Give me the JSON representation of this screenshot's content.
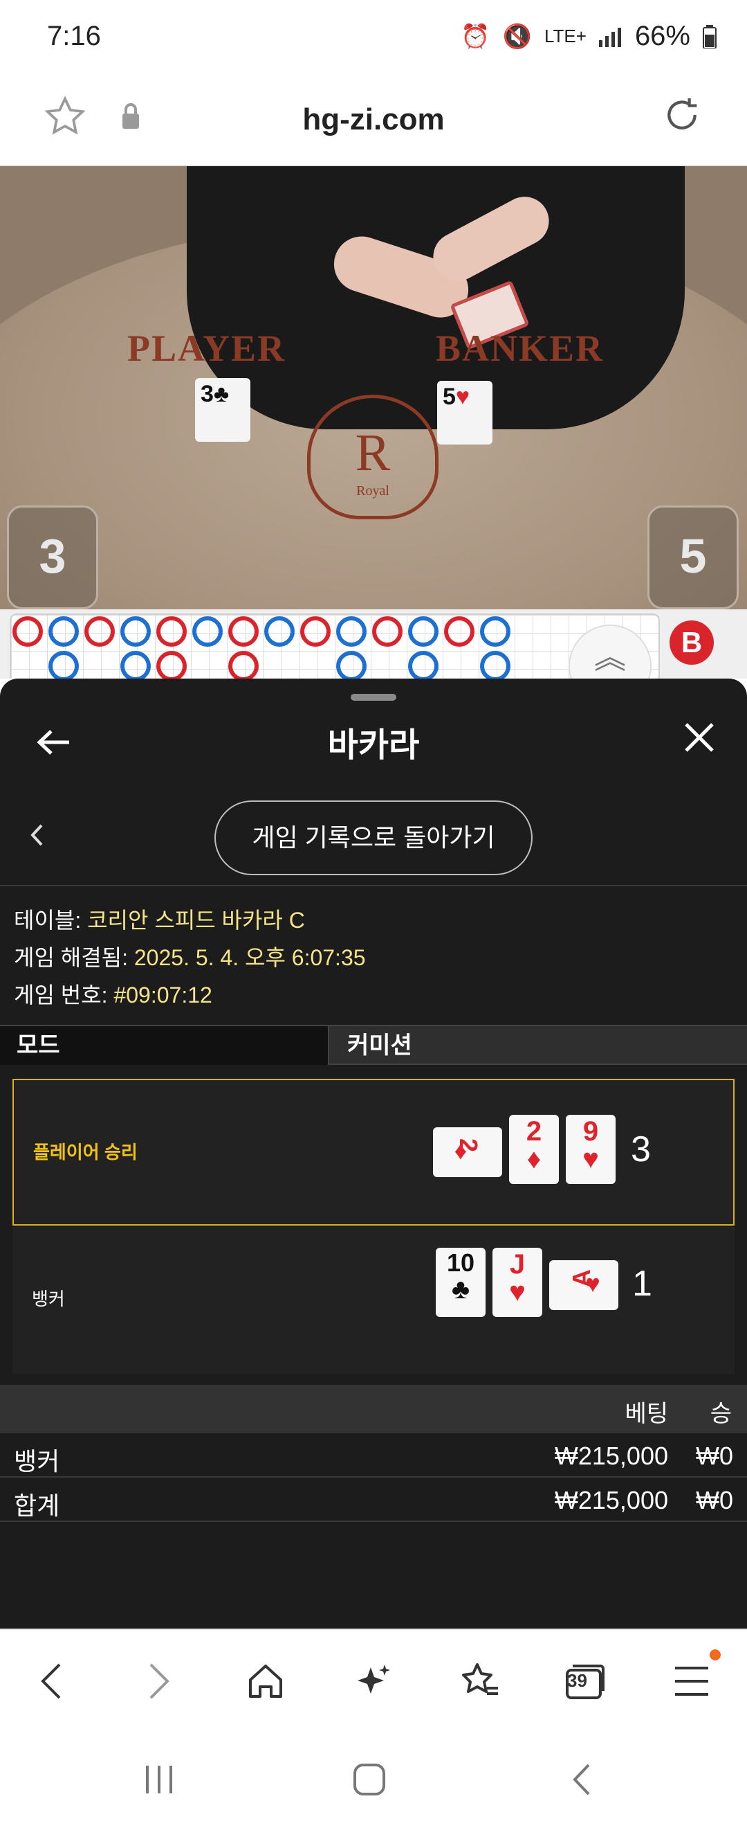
{
  "status_bar": {
    "time": "7:16",
    "network": "LTE+",
    "battery": "66%"
  },
  "address_bar": {
    "url": "hg-zi.com"
  },
  "video": {
    "player_label": "PLAYER",
    "banker_label": "BANKER",
    "player_card": "3",
    "banker_card": "5",
    "crest_letter": "R",
    "crest_word": "Royal",
    "player_score": "3",
    "banker_score": "5"
  },
  "roadmap": {
    "badge": "B"
  },
  "sheet": {
    "title": "바카라",
    "return_button": "게임 기록으로 돌아가기",
    "info": {
      "table_label": "테이블:",
      "table_value": "코리안 스피드 바카라 C",
      "resolved_label": "게임 해결됨:",
      "resolved_value": "2025. 5. 4. 오후 6:07:35",
      "number_label": "게임 번호:",
      "number_value": "#09:07:12"
    },
    "tabs": {
      "mode": "모드",
      "commission": "커미션"
    },
    "results": [
      {
        "label": "플레이어 승리",
        "total": "3",
        "cards": [
          {
            "rank": "2",
            "suit": "♦"
          },
          {
            "rank": "2",
            "suit": "♦"
          },
          {
            "rank": "9",
            "suit": "♥"
          }
        ]
      },
      {
        "label": "뱅커",
        "total": "1",
        "cards": [
          {
            "rank": "10",
            "suit": "♣"
          },
          {
            "rank": "J",
            "suit": "♥"
          },
          {
            "rank": "A",
            "suit": "♥"
          }
        ]
      }
    ],
    "bets": {
      "header_bet": "베팅",
      "header_win": "승",
      "rows": [
        {
          "name": "뱅커",
          "bet": "₩215,000",
          "win": "₩0"
        },
        {
          "name": "합계",
          "bet": "₩215,000",
          "win": "₩0"
        }
      ]
    }
  },
  "toolbar": {
    "tabs_count": "39"
  },
  "colors": {
    "sheet_bg": "#1c1c1c",
    "win_accent": "#f2c21b",
    "card_red": "#e0222c",
    "info_value": "#f5e48a"
  }
}
